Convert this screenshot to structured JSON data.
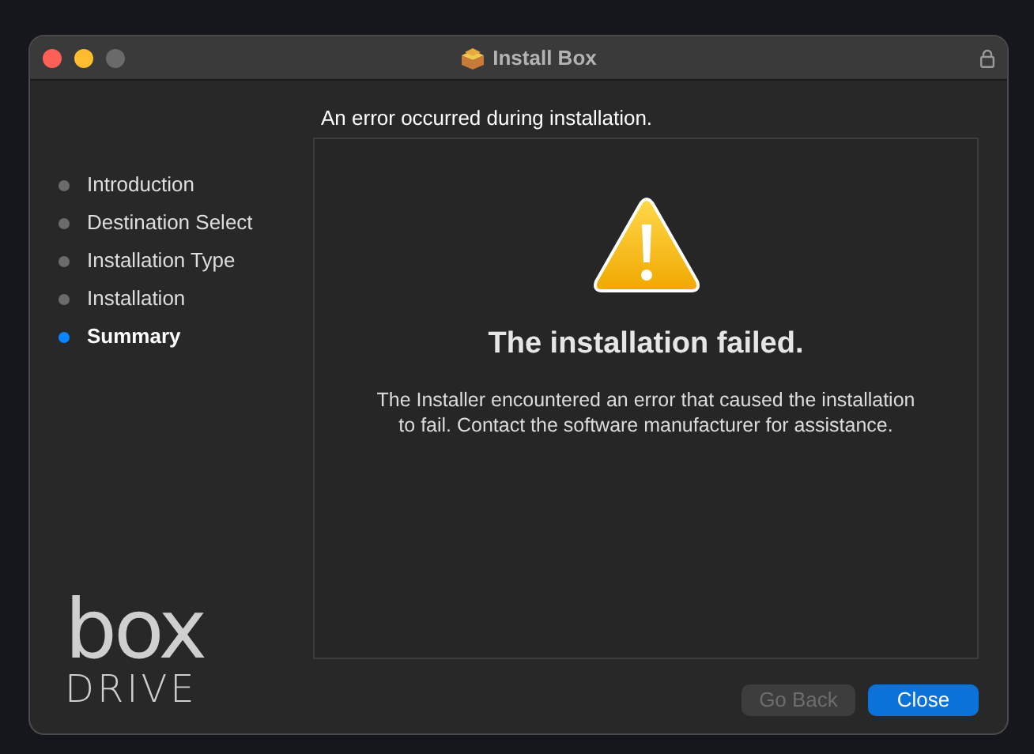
{
  "window": {
    "title": "Install Box"
  },
  "header": "An error occurred during installation.",
  "steps": [
    {
      "label": "Introduction",
      "selected": false
    },
    {
      "label": "Destination Select",
      "selected": false
    },
    {
      "label": "Installation Type",
      "selected": false
    },
    {
      "label": "Installation",
      "selected": false
    },
    {
      "label": "Summary",
      "selected": true
    }
  ],
  "logo": {
    "wordmark": "box",
    "subtitle": "DRIVE"
  },
  "message": {
    "title": "The installation failed.",
    "body": "The Installer encountered an error that caused the installation to fail. Contact the software manufacturer for assistance."
  },
  "buttons": [
    {
      "label": "Go Back",
      "disabled": true,
      "kind": "secondary"
    },
    {
      "label": "Close",
      "disabled": false,
      "kind": "primary"
    }
  ]
}
